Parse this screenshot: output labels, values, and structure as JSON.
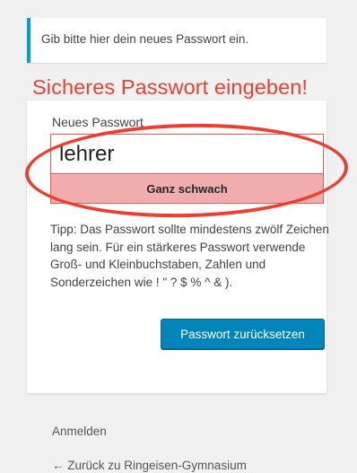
{
  "message": {
    "text": "Gib bitte hier dein neues Passwort ein."
  },
  "annotation": {
    "title": "Sicheres Passwort eingeben!"
  },
  "form": {
    "field_label": "Neues Passwort",
    "password_value": "lehrer",
    "strength_label": "Ganz schwach",
    "hint": "Tipp: Das Passwort sollte mindestens zwölf Zeichen lang sein. Für ein stärkeres Passwort verwende Groß- und Kleinbuchstaben, Zahlen und Sonderzeichen wie ! \" ? $ % ^ & ).",
    "submit_label": "Passwort zurücksetzen"
  },
  "nav": {
    "login_label": "Anmelden",
    "back_label": "← Zurück zu Ringeisen-Gymnasium"
  },
  "colors": {
    "accent": "#0085ba",
    "message_border": "#00a0d2",
    "annotation": "#e84133",
    "strength_bg": "#f1adad",
    "strength_border": "#e35b5b"
  }
}
